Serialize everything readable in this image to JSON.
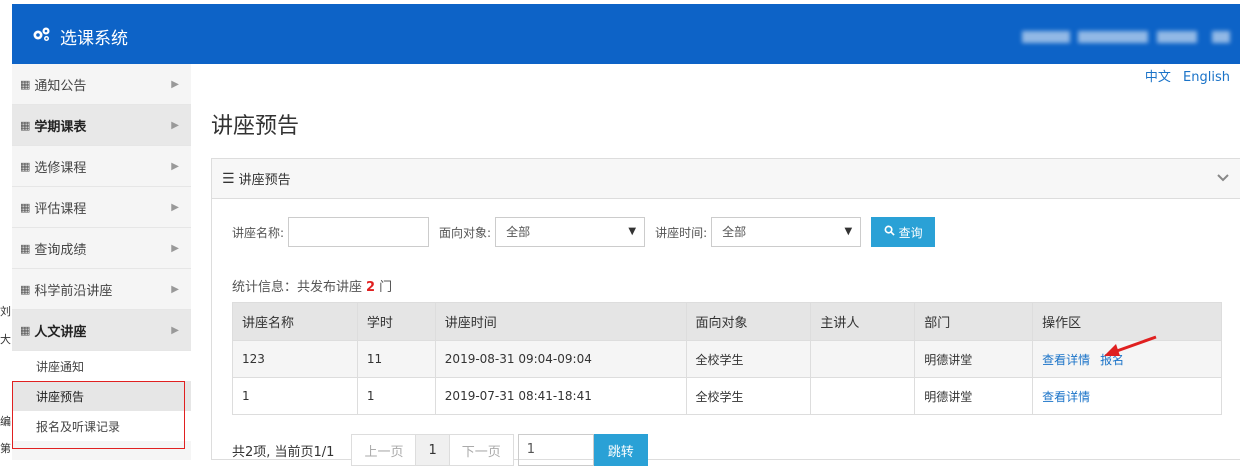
{
  "header": {
    "app_title": "选课系统",
    "brand_color": "#0d63c7"
  },
  "left_clip": [
    "刘",
    "大",
    "编",
    "第"
  ],
  "sidebar": {
    "items": [
      {
        "label": "通知公告"
      },
      {
        "label": "学期课表"
      },
      {
        "label": "选修课程"
      },
      {
        "label": "评估课程"
      },
      {
        "label": "查询成绩"
      },
      {
        "label": "科学前沿讲座"
      },
      {
        "label": "人文讲座"
      }
    ],
    "subitems": [
      {
        "label": "讲座通知"
      },
      {
        "label": "讲座预告"
      },
      {
        "label": "报名及听课记录"
      }
    ]
  },
  "lang": {
    "zh": "中文",
    "en": "English"
  },
  "page": {
    "title": "讲座预告"
  },
  "panel": {
    "title": "讲座预告"
  },
  "filters": {
    "name_label": "讲座名称:",
    "name_value": "",
    "audience_label": "面向对象:",
    "audience_value": "全部",
    "time_label": "讲座时间:",
    "time_value": "全部",
    "query_label": "查询"
  },
  "stats": {
    "prefix": "统计信息：共发布讲座",
    "count": "2",
    "suffix": "门"
  },
  "table": {
    "headers": [
      "讲座名称",
      "学时",
      "讲座时间",
      "面向对象",
      "主讲人",
      "部门",
      "操作区"
    ],
    "rows": [
      {
        "name": "123",
        "hours": "11",
        "time": "2019-08-31 09:04-09:04",
        "audience": "全校学生",
        "speaker": "",
        "dept": "明德讲堂",
        "detail": "查看详情",
        "signup": "报名"
      },
      {
        "name": "1",
        "hours": "1",
        "time": "2019-07-31 08:41-18:41",
        "audience": "全校学生",
        "speaker": "",
        "dept": "明德讲堂",
        "detail": "查看详情"
      }
    ]
  },
  "pager": {
    "info": "共2项, 当前页1/1",
    "prev": "上一页",
    "current": "1",
    "next": "下一页",
    "jump_value": "1",
    "jump_label": "跳转"
  },
  "colors": {
    "accent": "#2aa1d6",
    "highlight_red": "#e02020",
    "link": "#1a73c8"
  }
}
